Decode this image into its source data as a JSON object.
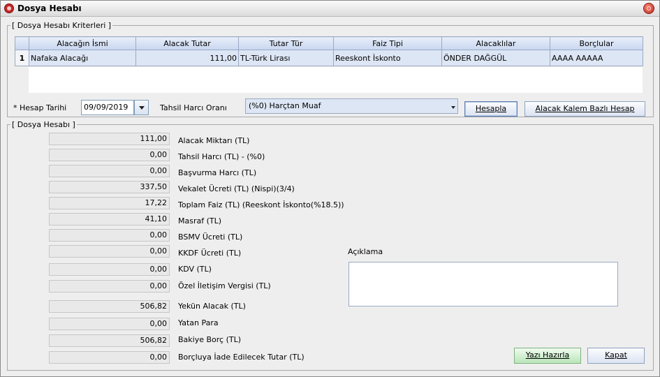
{
  "window": {
    "title": "Dosya Hesabı"
  },
  "criteria": {
    "group_label": "[ Dosya Hesabı Kriterleri ]",
    "columns": [
      "Alacağın İsmi",
      "Alacak Tutar",
      "Tutar Tür",
      "Faiz Tipi",
      "Alacaklılar",
      "Borçlular"
    ],
    "rows": [
      {
        "num": "1",
        "cells": [
          "Nafaka Alacağı",
          "111,00",
          "TL-Türk Lirası",
          "Reeskont İskonto",
          "ÖNDER DAĞGÜL",
          "AAAA AAAAA"
        ]
      }
    ]
  },
  "controls": {
    "date_label": "* Hesap Tarihi",
    "date_value": "09/09/2019",
    "harc_label": "Tahsil Harcı Oranı",
    "harc_value": "(%0) Harçtan Muaf",
    "hesapla": "Hesapla",
    "alacak_kalem": "Alacak Kalem Bazlı Hesap"
  },
  "summary": {
    "group_label": "[ Dosya Hesabı ]",
    "rows": [
      {
        "value": "111,00",
        "label": "Alacak Miktarı (TL)"
      },
      {
        "value": "0,00",
        "label": "Tahsil Harcı (TL)  - (%0)"
      },
      {
        "value": "0,00",
        "label": "Başvurma Harcı (TL)"
      },
      {
        "value": "337,50",
        "label": "Vekalet Ücreti (TL)  (Nispi)(3/4)"
      },
      {
        "value": "17,22",
        "label": "Toplam Faiz (TL)  (Reeskont İskonto(%18.5))"
      },
      {
        "value": "41,10",
        "label": "Masraf (TL)"
      },
      {
        "value": "0,00",
        "label": "BSMV Ücreti (TL)"
      },
      {
        "value": "0,00",
        "label": "KKDF Ücreti (TL)"
      },
      {
        "value": "0,00",
        "label": "KDV (TL)"
      },
      {
        "value": "0,00",
        "label": "Özel İletişim Vergisi (TL)"
      },
      {
        "value": "506,82",
        "label": "Yekün Alacak (TL)"
      },
      {
        "value": "0,00",
        "label": "Yatan Para"
      },
      {
        "value": "506,82",
        "label": "Bakiye Borç (TL)"
      },
      {
        "value": "0,00",
        "label": "Borçluya İade Edilecek Tutar (TL)"
      }
    ],
    "aciklama_label": "Açıklama",
    "aciklama_value": ""
  },
  "buttons": {
    "yazi": "Yazı Hazırla",
    "kapat": "Kapat"
  }
}
